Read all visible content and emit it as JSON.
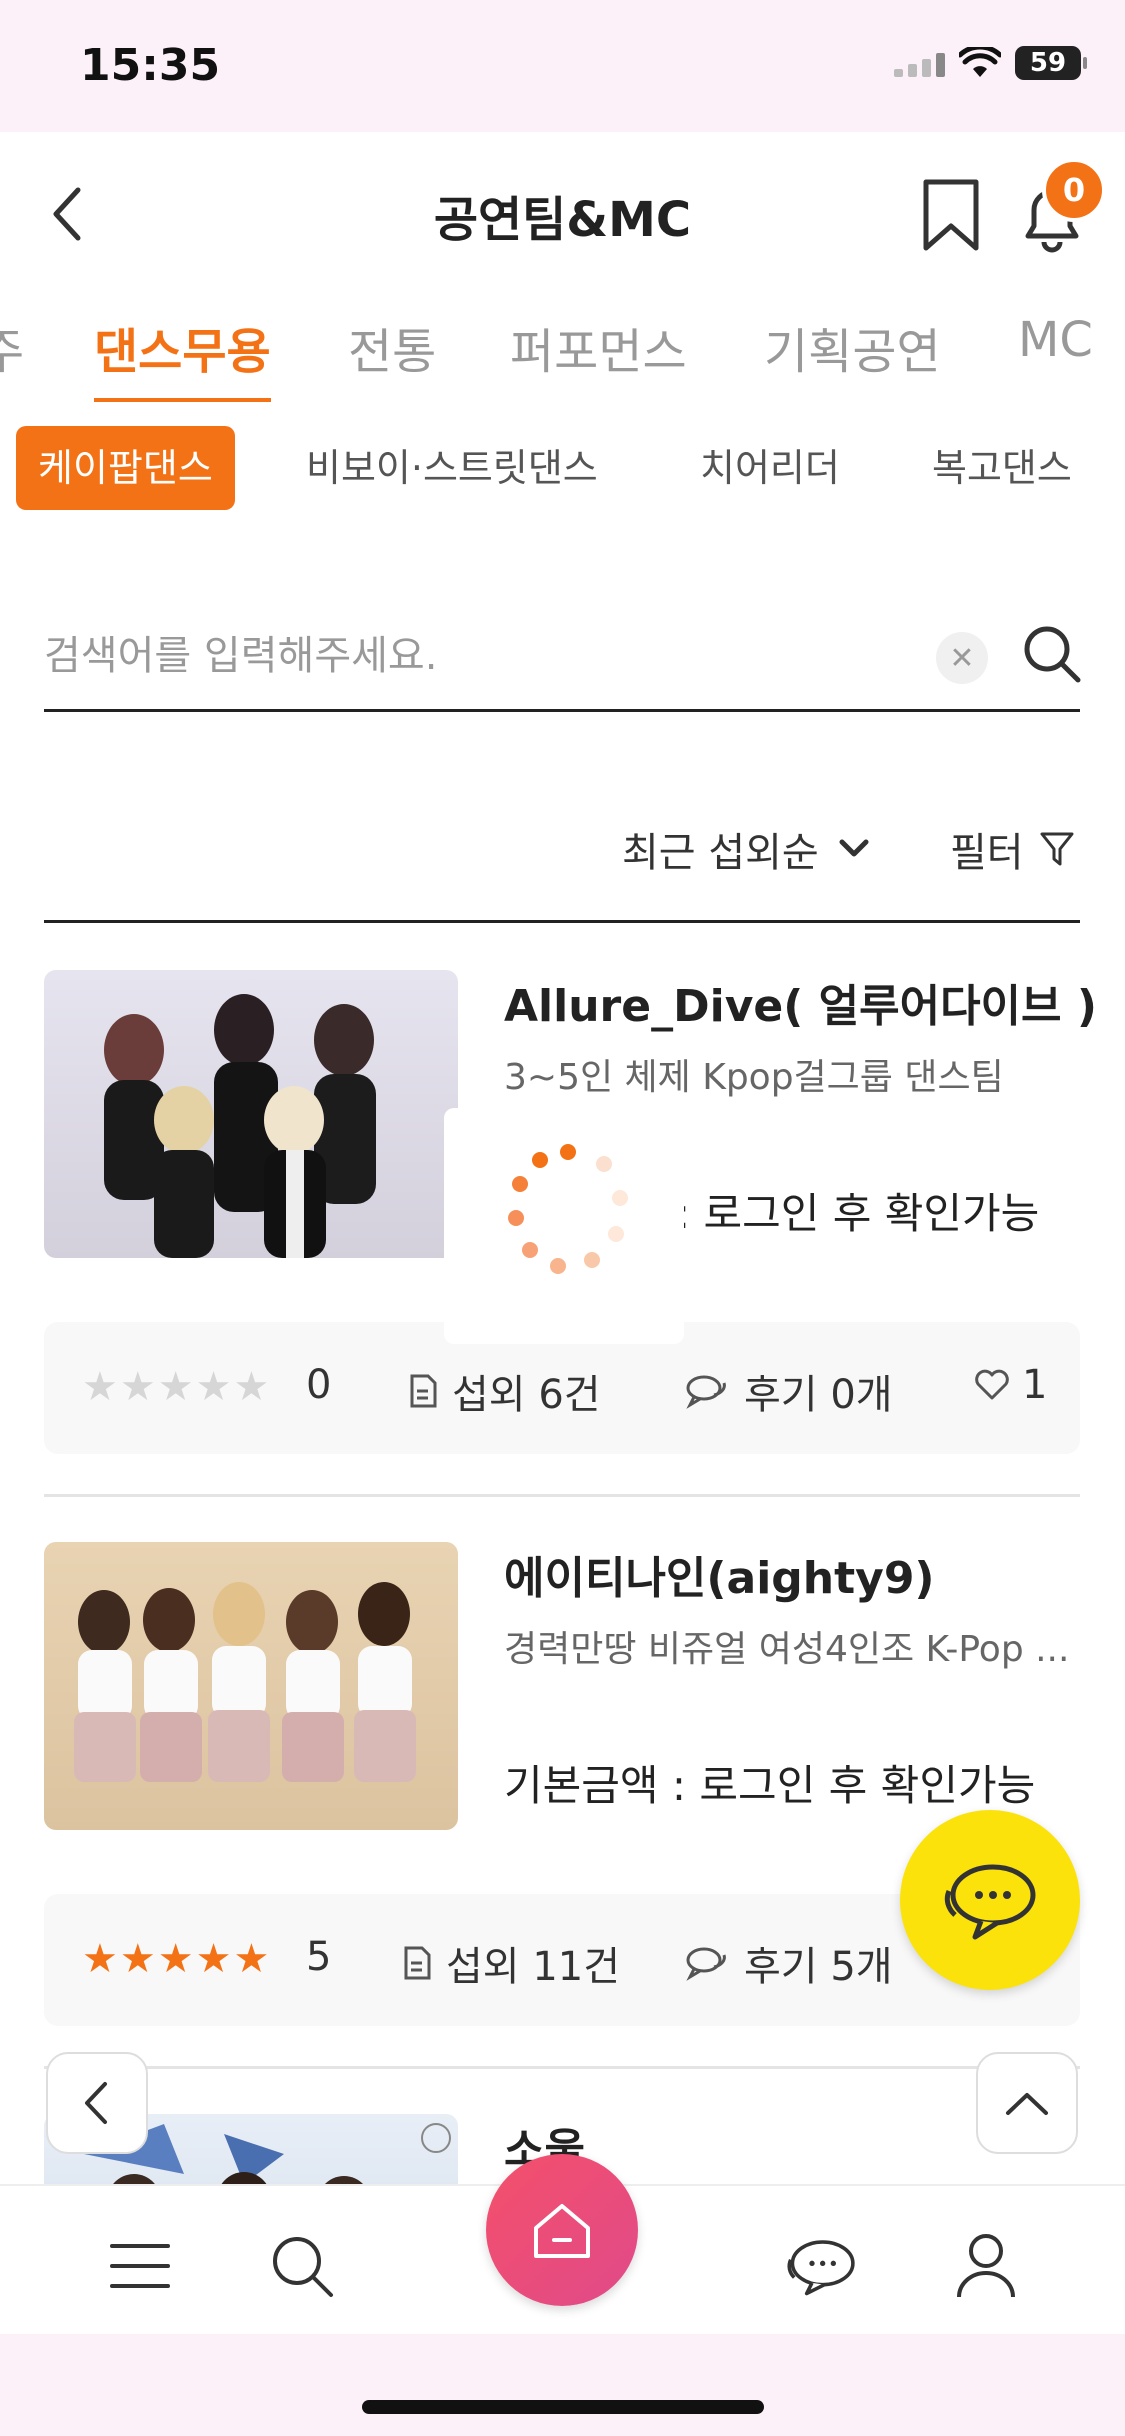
{
  "status_bar": {
    "time": "15:35",
    "battery": "59"
  },
  "header": {
    "title": "공연팀&MC",
    "notification_count": "0"
  },
  "category_tabs": [
    {
      "label": "주",
      "active": false
    },
    {
      "label": "댄스무용",
      "active": true
    },
    {
      "label": "전통",
      "active": false
    },
    {
      "label": "퍼포먼스",
      "active": false
    },
    {
      "label": "기획공연",
      "active": false
    },
    {
      "label": "MC",
      "active": false
    }
  ],
  "sub_tabs": [
    {
      "label": "케이팝댄스",
      "active": true
    },
    {
      "label": "비보이·스트릿댄스",
      "active": false
    },
    {
      "label": "치어리더",
      "active": false
    },
    {
      "label": "복고댄스",
      "active": false
    }
  ],
  "search": {
    "placeholder": "검색어를 입력해주세요.",
    "value": ""
  },
  "sort": {
    "label": "최근 섭외순",
    "filter_label": "필터"
  },
  "items": [
    {
      "name": "Allure_Dive( 얼루어다이브 )",
      "desc": "3~5인 체제 Kpop걸그룹 댄스팀",
      "price": ": 로그인 후 확인가능",
      "stars": "★★★★★",
      "rating": "0",
      "booking": "섭외 6건",
      "reviews": "후기 0개",
      "likes": "1"
    },
    {
      "name": "에이티나인(aighty9)",
      "desc": "경력만땅 비쥬얼 여성4인조 K-Pop ...",
      "price": "기본금액 : 로그인 후 확인가능",
      "stars": "★★★★★",
      "rating": "5",
      "booking": "섭외 11건",
      "reviews": "후기 5개",
      "likes": ""
    },
    {
      "name": "소울"
    }
  ],
  "colors": {
    "accent": "#f47216",
    "kakao": "#fbe20a",
    "home_gradient": "#e04a8a"
  }
}
